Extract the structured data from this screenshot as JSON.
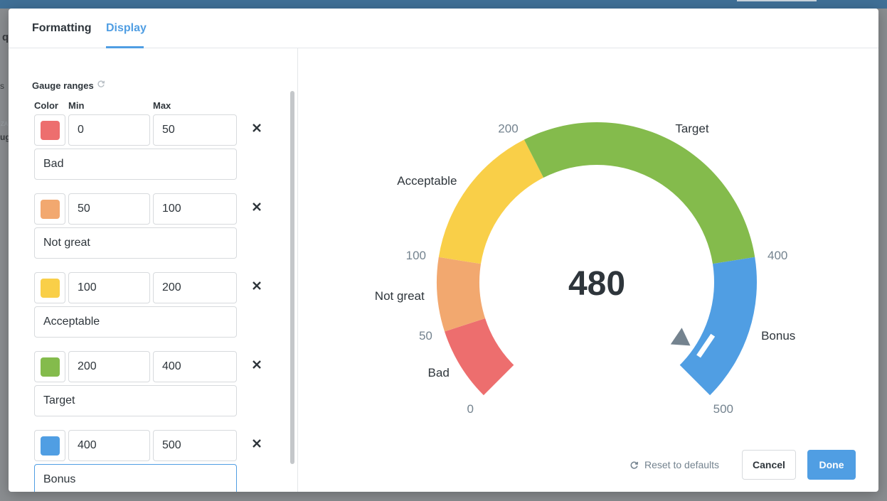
{
  "tabs": [
    {
      "label": "Formatting",
      "active": false
    },
    {
      "label": "Display",
      "active": true
    }
  ],
  "backdrop": {
    "frag_q": "q",
    "frag_s": "s",
    "frag_za": "ZA",
    "frag_ug": "ug"
  },
  "gauge_ranges": {
    "title": "Gauge ranges",
    "columns": {
      "color": "Color",
      "min": "Min",
      "max": "Max"
    },
    "ranges": [
      {
        "color": "#ED6E6E",
        "min": "0",
        "max": "50",
        "label": "Bad"
      },
      {
        "color": "#F2A86F",
        "min": "50",
        "max": "100",
        "label": "Not great"
      },
      {
        "color": "#F9CF48",
        "min": "100",
        "max": "200",
        "label": "Acceptable"
      },
      {
        "color": "#84BB4C",
        "min": "200",
        "max": "400",
        "label": "Target"
      },
      {
        "color": "#509EE3",
        "min": "400",
        "max": "500",
        "label": "Bonus"
      }
    ]
  },
  "gauge": {
    "value": 480,
    "value_text": "480",
    "min": 0,
    "max": 500,
    "needle_color": "#74838F",
    "ticks": [
      "0",
      "50",
      "100",
      "200",
      "400",
      "500"
    ],
    "tick_values": [
      0,
      50,
      100,
      200,
      400,
      500
    ]
  },
  "actions": {
    "reset_label": "Reset to defaults",
    "cancel_label": "Cancel",
    "done_label": "Done"
  }
}
